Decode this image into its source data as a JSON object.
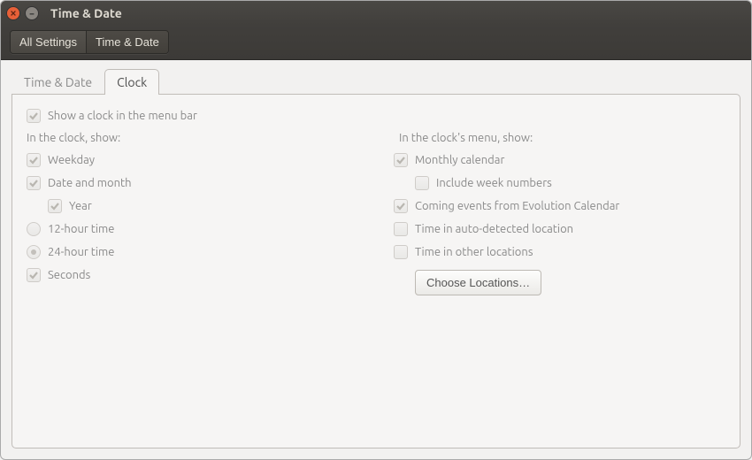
{
  "window": {
    "title": "Time & Date"
  },
  "toolbar": {
    "all_settings": "All Settings",
    "current": "Time & Date"
  },
  "tabs": {
    "time_date": "Time & Date",
    "clock": "Clock"
  },
  "main": {
    "show_clock": "Show a clock in the menu bar",
    "left": {
      "heading": "In the clock, show:",
      "weekday": "Weekday",
      "date_month": "Date and month",
      "year": "Year",
      "hour12": "12-hour time",
      "hour24": "24-hour time",
      "seconds": "Seconds"
    },
    "right": {
      "heading": "In the clock's menu, show:",
      "monthly_calendar": "Monthly calendar",
      "include_week_numbers": "Include week numbers",
      "coming_events": "Coming events from Evolution Calendar",
      "time_auto_location": "Time in auto-detected location",
      "time_other_locations": "Time in other locations",
      "choose_locations": "Choose Locations…"
    }
  }
}
